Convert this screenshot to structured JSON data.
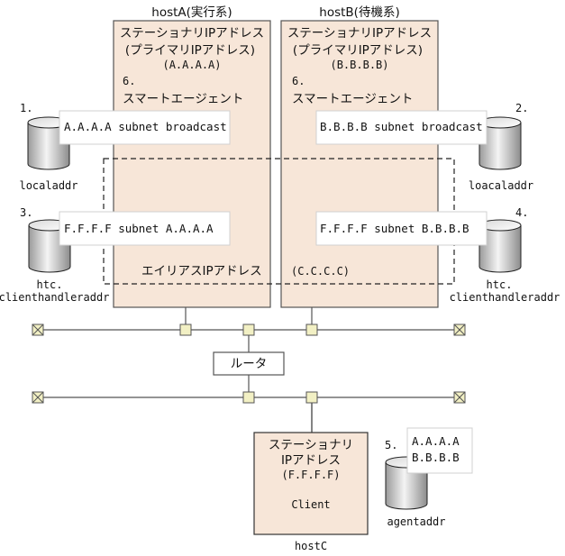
{
  "hosts": {
    "hostA": {
      "title": "hostA(実行系)",
      "line1": "ステーショナリIPアドレス",
      "line2": "(プライマリIPアドレス)",
      "address": "(A.A.A.A)",
      "step": "6.",
      "agent": "スマートエージェント"
    },
    "hostB": {
      "title": "hostB(待機系)",
      "line1": "ステーショナリIPアドレス",
      "line2": "(プライマリIPアドレス)",
      "address": "(B.B.B.B)",
      "step": "6.",
      "agent": "スマートエージェント"
    },
    "hostC": {
      "title": "hostC",
      "line1": "ステーショナリ",
      "line2": "IPアドレス",
      "address": "(F.F.F.F)",
      "client": "Client"
    }
  },
  "alias": {
    "label": "エイリアスIPアドレス",
    "address": "(C.C.C.C)"
  },
  "files": [
    {
      "step": "1.",
      "name": "localaddr",
      "content": [
        "A.A.A.A subnet broadcast"
      ]
    },
    {
      "step": "2.",
      "name": "loacaladdr",
      "content": [
        "B.B.B.B subnet broadcast"
      ]
    },
    {
      "step": "3.",
      "name_line1": "htc.",
      "name_line2": "clienthandleraddr",
      "content": [
        "F.F.F.F subnet A.A.A.A"
      ]
    },
    {
      "step": "4.",
      "name_line1": "htc.",
      "name_line2": "clienthandleraddr",
      "content": [
        "F.F.F.F subnet B.B.B.B"
      ]
    },
    {
      "step": "5.",
      "name": "agentaddr",
      "content": [
        "A.A.A.A",
        "B.B.B.B"
      ]
    }
  ],
  "network": {
    "router_label": "ルータ"
  },
  "colors": {
    "host_fill": "#f7e6d8",
    "host_stroke": "#555555",
    "node_fill": "#f2f0c4",
    "line": "#555555"
  }
}
